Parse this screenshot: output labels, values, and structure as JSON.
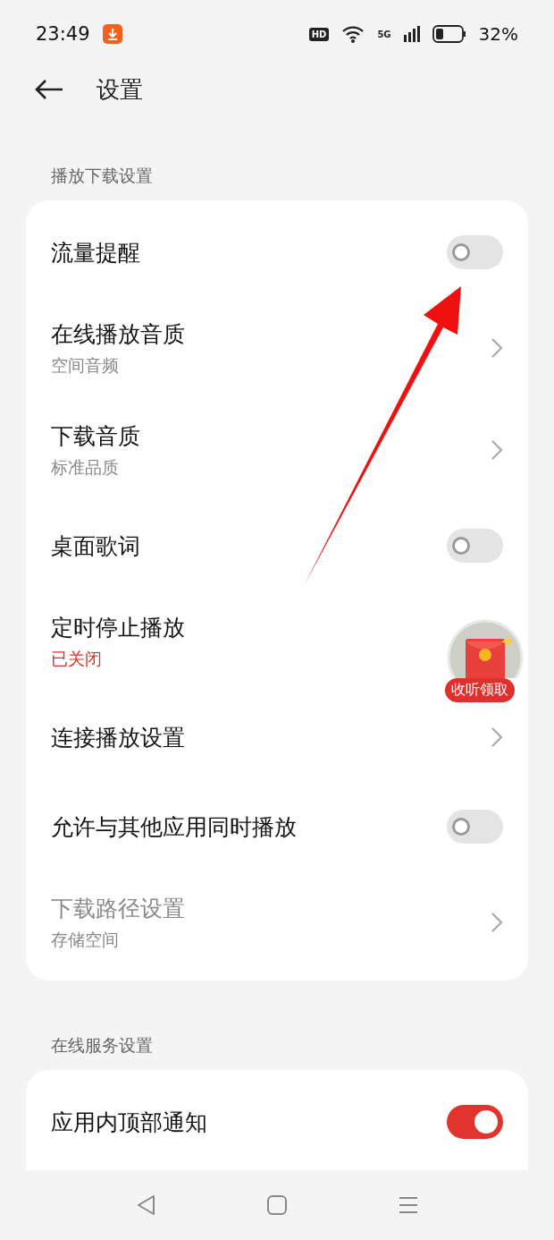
{
  "status_bar": {
    "time": "23:49",
    "hd": "HD",
    "network": "5G",
    "battery": "32%"
  },
  "header": {
    "title": "设置"
  },
  "sections": [
    {
      "title": "播放下载设置",
      "rows": [
        {
          "kind": "toggle",
          "label": "流量提醒",
          "on": false,
          "disabled": false
        },
        {
          "kind": "link",
          "label": "在线播放音质",
          "subtitle": "空间音频",
          "alert": false,
          "disabled": false
        },
        {
          "kind": "link",
          "label": "下载音质",
          "subtitle": "标准品质",
          "alert": false,
          "disabled": false
        },
        {
          "kind": "toggle",
          "label": "桌面歌词",
          "on": false,
          "disabled": false
        },
        {
          "kind": "text",
          "label": "定时停止播放",
          "subtitle": "已关闭",
          "alert": true,
          "disabled": false
        },
        {
          "kind": "link",
          "label": "连接播放设置",
          "disabled": false
        },
        {
          "kind": "toggle",
          "label": "允许与其他应用同时播放",
          "on": false,
          "disabled": false
        },
        {
          "kind": "link",
          "label": "下载路径设置",
          "subtitle": "存储空间",
          "alert": false,
          "disabled": true
        }
      ]
    },
    {
      "title": "在线服务设置",
      "rows": [
        {
          "kind": "toggle",
          "label": "应用内顶部通知",
          "on": true,
          "disabled": false
        }
      ]
    }
  ],
  "floating_badge": {
    "label": "收听领取"
  }
}
